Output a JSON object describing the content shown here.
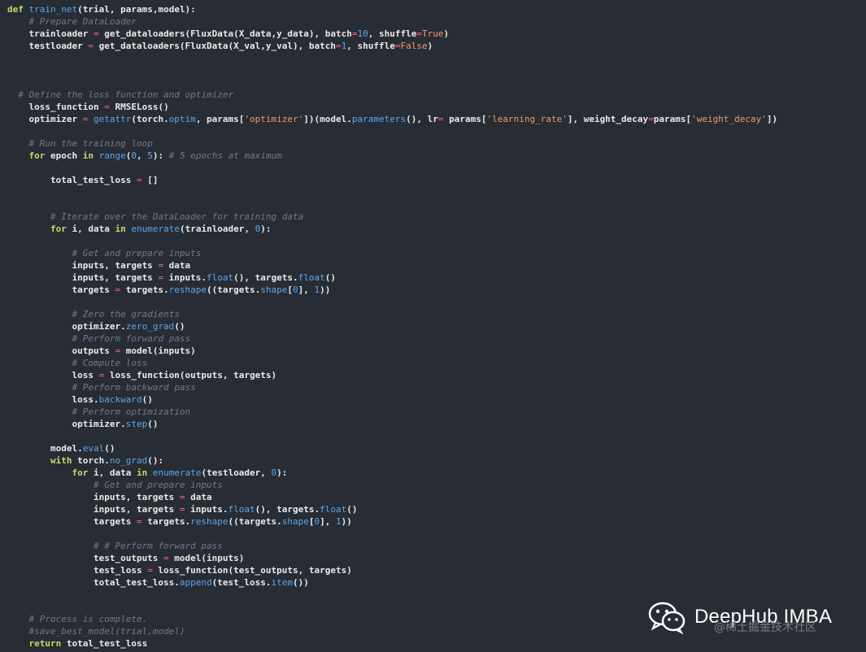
{
  "code_lines": [
    [
      {
        "t": "def",
        "c": "kw"
      },
      {
        "t": " ",
        "c": "txt"
      },
      {
        "t": "train_net",
        "c": "fn"
      },
      {
        "t": "(trial, params,model):",
        "c": "txt"
      }
    ],
    [
      {
        "t": "    ",
        "c": "txt"
      },
      {
        "t": "# Prepare DataLoader",
        "c": "cm"
      }
    ],
    [
      {
        "t": "    trainloader ",
        "c": "txt"
      },
      {
        "t": "=",
        "c": "op"
      },
      {
        "t": " get_dataloaders(FluxData(X_data,y_data), batch",
        "c": "txt"
      },
      {
        "t": "=",
        "c": "op"
      },
      {
        "t": "10",
        "c": "num"
      },
      {
        "t": ", shuffle",
        "c": "txt"
      },
      {
        "t": "=",
        "c": "op"
      },
      {
        "t": "True",
        "c": "str"
      },
      {
        "t": ")",
        "c": "txt"
      }
    ],
    [
      {
        "t": "    testloader ",
        "c": "txt"
      },
      {
        "t": "=",
        "c": "op"
      },
      {
        "t": " get_dataloaders(FluxData(X_val,y_val), batch",
        "c": "txt"
      },
      {
        "t": "=",
        "c": "op"
      },
      {
        "t": "1",
        "c": "num"
      },
      {
        "t": ", shuffle",
        "c": "txt"
      },
      {
        "t": "=",
        "c": "op"
      },
      {
        "t": "False",
        "c": "str"
      },
      {
        "t": ")",
        "c": "txt"
      }
    ],
    [],
    [],
    [],
    [
      {
        "t": "  ",
        "c": "txt"
      },
      {
        "t": "# Define the loss function and optimizer",
        "c": "cm"
      }
    ],
    [
      {
        "t": "    loss_function ",
        "c": "txt"
      },
      {
        "t": "=",
        "c": "op"
      },
      {
        "t": " RMSELoss()",
        "c": "txt"
      }
    ],
    [
      {
        "t": "    optimizer ",
        "c": "txt"
      },
      {
        "t": "=",
        "c": "op"
      },
      {
        "t": " ",
        "c": "txt"
      },
      {
        "t": "getattr",
        "c": "fn"
      },
      {
        "t": "(torch.",
        "c": "txt"
      },
      {
        "t": "optim",
        "c": "fn"
      },
      {
        "t": ", params[",
        "c": "txt"
      },
      {
        "t": "'optimizer'",
        "c": "str"
      },
      {
        "t": "])(model.",
        "c": "txt"
      },
      {
        "t": "parameters",
        "c": "fn"
      },
      {
        "t": "(), lr",
        "c": "txt"
      },
      {
        "t": "=",
        "c": "op"
      },
      {
        "t": " params[",
        "c": "txt"
      },
      {
        "t": "'learning_rate'",
        "c": "str"
      },
      {
        "t": "], weight_decay",
        "c": "txt"
      },
      {
        "t": "=",
        "c": "op"
      },
      {
        "t": "params[",
        "c": "txt"
      },
      {
        "t": "'weight_decay'",
        "c": "str"
      },
      {
        "t": "])",
        "c": "txt"
      }
    ],
    [],
    [
      {
        "t": "    ",
        "c": "txt"
      },
      {
        "t": "# Run the training loop",
        "c": "cm"
      }
    ],
    [
      {
        "t": "    ",
        "c": "txt"
      },
      {
        "t": "for",
        "c": "kw"
      },
      {
        "t": " epoch ",
        "c": "txt"
      },
      {
        "t": "in",
        "c": "kw"
      },
      {
        "t": " ",
        "c": "txt"
      },
      {
        "t": "range",
        "c": "fn"
      },
      {
        "t": "(",
        "c": "txt"
      },
      {
        "t": "0",
        "c": "num"
      },
      {
        "t": ", ",
        "c": "txt"
      },
      {
        "t": "5",
        "c": "num"
      },
      {
        "t": "): ",
        "c": "txt"
      },
      {
        "t": "# 5 epochs at maximum",
        "c": "cm"
      }
    ],
    [],
    [
      {
        "t": "        total_test_loss ",
        "c": "txt"
      },
      {
        "t": "=",
        "c": "op"
      },
      {
        "t": " []",
        "c": "txt"
      }
    ],
    [],
    [],
    [
      {
        "t": "        ",
        "c": "txt"
      },
      {
        "t": "# Iterate over the DataLoader for training data",
        "c": "cm"
      }
    ],
    [
      {
        "t": "        ",
        "c": "txt"
      },
      {
        "t": "for",
        "c": "kw"
      },
      {
        "t": " i, data ",
        "c": "txt"
      },
      {
        "t": "in",
        "c": "kw"
      },
      {
        "t": " ",
        "c": "txt"
      },
      {
        "t": "enumerate",
        "c": "fn"
      },
      {
        "t": "(trainloader, ",
        "c": "txt"
      },
      {
        "t": "0",
        "c": "num"
      },
      {
        "t": "):",
        "c": "txt"
      }
    ],
    [],
    [
      {
        "t": "            ",
        "c": "txt"
      },
      {
        "t": "# Get and prepare inputs",
        "c": "cm"
      }
    ],
    [
      {
        "t": "            inputs, targets ",
        "c": "txt"
      },
      {
        "t": "=",
        "c": "op"
      },
      {
        "t": " data",
        "c": "txt"
      }
    ],
    [
      {
        "t": "            inputs, targets ",
        "c": "txt"
      },
      {
        "t": "=",
        "c": "op"
      },
      {
        "t": " inputs.",
        "c": "txt"
      },
      {
        "t": "float",
        "c": "fn"
      },
      {
        "t": "(), targets.",
        "c": "txt"
      },
      {
        "t": "float",
        "c": "fn"
      },
      {
        "t": "()",
        "c": "txt"
      }
    ],
    [
      {
        "t": "            targets ",
        "c": "txt"
      },
      {
        "t": "=",
        "c": "op"
      },
      {
        "t": " targets.",
        "c": "txt"
      },
      {
        "t": "reshape",
        "c": "fn"
      },
      {
        "t": "((targets.",
        "c": "txt"
      },
      {
        "t": "shape",
        "c": "fn"
      },
      {
        "t": "[",
        "c": "txt"
      },
      {
        "t": "0",
        "c": "num"
      },
      {
        "t": "], ",
        "c": "txt"
      },
      {
        "t": "1",
        "c": "num"
      },
      {
        "t": "))",
        "c": "txt"
      }
    ],
    [],
    [
      {
        "t": "            ",
        "c": "txt"
      },
      {
        "t": "# Zero the gradients",
        "c": "cm"
      }
    ],
    [
      {
        "t": "            optimizer.",
        "c": "txt"
      },
      {
        "t": "zero_grad",
        "c": "fn"
      },
      {
        "t": "()",
        "c": "txt"
      }
    ],
    [
      {
        "t": "            ",
        "c": "txt"
      },
      {
        "t": "# Perform forward pass",
        "c": "cm"
      }
    ],
    [
      {
        "t": "            outputs ",
        "c": "txt"
      },
      {
        "t": "=",
        "c": "op"
      },
      {
        "t": " model(inputs)",
        "c": "txt"
      }
    ],
    [
      {
        "t": "            ",
        "c": "txt"
      },
      {
        "t": "# Compute loss",
        "c": "cm"
      }
    ],
    [
      {
        "t": "            loss ",
        "c": "txt"
      },
      {
        "t": "=",
        "c": "op"
      },
      {
        "t": " loss_function(outputs, targets)",
        "c": "txt"
      }
    ],
    [
      {
        "t": "            ",
        "c": "txt"
      },
      {
        "t": "# Perform backward pass",
        "c": "cm"
      }
    ],
    [
      {
        "t": "            loss.",
        "c": "txt"
      },
      {
        "t": "backward",
        "c": "fn"
      },
      {
        "t": "()",
        "c": "txt"
      }
    ],
    [
      {
        "t": "            ",
        "c": "txt"
      },
      {
        "t": "# Perform optimization",
        "c": "cm"
      }
    ],
    [
      {
        "t": "            optimizer.",
        "c": "txt"
      },
      {
        "t": "step",
        "c": "fn"
      },
      {
        "t": "()",
        "c": "txt"
      }
    ],
    [],
    [
      {
        "t": "        model.",
        "c": "txt"
      },
      {
        "t": "eval",
        "c": "fn"
      },
      {
        "t": "()",
        "c": "txt"
      }
    ],
    [
      {
        "t": "        ",
        "c": "txt"
      },
      {
        "t": "with",
        "c": "kw"
      },
      {
        "t": " torch.",
        "c": "txt"
      },
      {
        "t": "no_grad",
        "c": "fn"
      },
      {
        "t": "():",
        "c": "txt"
      }
    ],
    [
      {
        "t": "            ",
        "c": "txt"
      },
      {
        "t": "for",
        "c": "kw"
      },
      {
        "t": " i, data ",
        "c": "txt"
      },
      {
        "t": "in",
        "c": "kw"
      },
      {
        "t": " ",
        "c": "txt"
      },
      {
        "t": "enumerate",
        "c": "fn"
      },
      {
        "t": "(testloader, ",
        "c": "txt"
      },
      {
        "t": "0",
        "c": "num"
      },
      {
        "t": "):",
        "c": "txt"
      }
    ],
    [
      {
        "t": "                ",
        "c": "txt"
      },
      {
        "t": "# Get and prepare inputs",
        "c": "cm"
      }
    ],
    [
      {
        "t": "                inputs, targets ",
        "c": "txt"
      },
      {
        "t": "=",
        "c": "op"
      },
      {
        "t": " data",
        "c": "txt"
      }
    ],
    [
      {
        "t": "                inputs, targets ",
        "c": "txt"
      },
      {
        "t": "=",
        "c": "op"
      },
      {
        "t": " inputs.",
        "c": "txt"
      },
      {
        "t": "float",
        "c": "fn"
      },
      {
        "t": "(), targets.",
        "c": "txt"
      },
      {
        "t": "float",
        "c": "fn"
      },
      {
        "t": "()",
        "c": "txt"
      }
    ],
    [
      {
        "t": "                targets ",
        "c": "txt"
      },
      {
        "t": "=",
        "c": "op"
      },
      {
        "t": " targets.",
        "c": "txt"
      },
      {
        "t": "reshape",
        "c": "fn"
      },
      {
        "t": "((targets.",
        "c": "txt"
      },
      {
        "t": "shape",
        "c": "fn"
      },
      {
        "t": "[",
        "c": "txt"
      },
      {
        "t": "0",
        "c": "num"
      },
      {
        "t": "], ",
        "c": "txt"
      },
      {
        "t": "1",
        "c": "num"
      },
      {
        "t": "))",
        "c": "txt"
      }
    ],
    [],
    [
      {
        "t": "                ",
        "c": "txt"
      },
      {
        "t": "# # Perform forward pass",
        "c": "cm"
      }
    ],
    [
      {
        "t": "                test_outputs ",
        "c": "txt"
      },
      {
        "t": "=",
        "c": "op"
      },
      {
        "t": " model(inputs)",
        "c": "txt"
      }
    ],
    [
      {
        "t": "                test_loss ",
        "c": "txt"
      },
      {
        "t": "=",
        "c": "op"
      },
      {
        "t": " loss_function(test_outputs, targets)",
        "c": "txt"
      }
    ],
    [
      {
        "t": "                total_test_loss.",
        "c": "txt"
      },
      {
        "t": "append",
        "c": "fn"
      },
      {
        "t": "(test_loss.",
        "c": "txt"
      },
      {
        "t": "item",
        "c": "fn"
      },
      {
        "t": "())",
        "c": "txt"
      }
    ],
    [],
    [],
    [
      {
        "t": "    ",
        "c": "txt"
      },
      {
        "t": "# Process is complete.",
        "c": "cm"
      }
    ],
    [
      {
        "t": "    ",
        "c": "txt"
      },
      {
        "t": "#save_best_model(trial,model)",
        "c": "cm"
      }
    ],
    [
      {
        "t": "    ",
        "c": "txt"
      },
      {
        "t": "return",
        "c": "kw"
      },
      {
        "t": " total_test_loss",
        "c": "txt"
      }
    ]
  ],
  "watermark": {
    "icon": "wechat-icon",
    "title": "DeepHub IMBA",
    "subtitle": "@稀土掘金技术社区"
  },
  "colors": {
    "background": "#282c34",
    "keyword": "#c0dc6e",
    "function": "#58a8f0",
    "comment": "#6f7b8d",
    "string": "#ee9d6c",
    "operator": "#ff6188"
  }
}
